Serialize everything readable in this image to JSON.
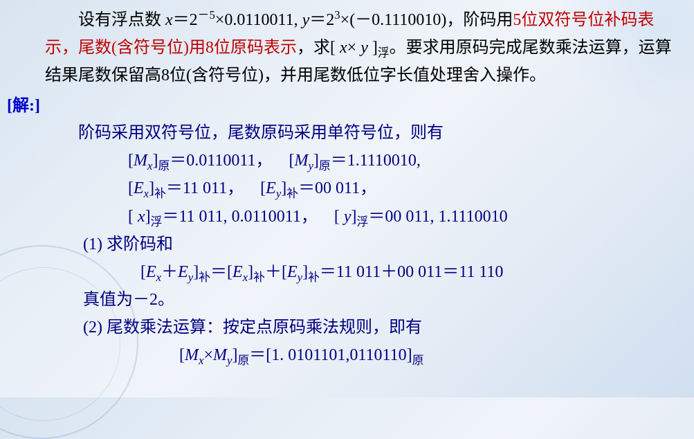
{
  "problem": {
    "line1_a": "设有浮点数 ",
    "line1_x": "x",
    "line1_b": "＝2",
    "line1_exp1": "－5",
    "line1_c": "×0.0110011, ",
    "line1_y": "y",
    "line1_d": "＝2",
    "line1_exp2": "3",
    "line1_e": "×(－0.1110010)，阶码用",
    "line1_red1": "5位双符号位补码表示，尾数(含符号位)用8位原码表示",
    "line1_f": "，求[ ",
    "line1_x2": "x",
    "line1_g": "× ",
    "line1_y2": "y",
    "line1_h": " ]",
    "line1_sub1": "浮",
    "line1_i": "。要求用原码完成尾数乘法运算，运算结果尾数保留高8位(含符号位)，并用尾数低位字长值处理舍入操作。"
  },
  "solution_label": "[解:]",
  "solution": {
    "intro": "阶码采用双符号位，尾数原码采用单符号位，则有",
    "mx_label_a": "[",
    "mx_label_b": "M",
    "mx_sub": "x",
    "mx_label_c": "]",
    "mx_sub2": "原",
    "mx_val": "＝0.0110011，",
    "my_label_a": "[",
    "my_label_b": "M",
    "my_sub": "y",
    "my_label_c": "]",
    "my_sub2": "原",
    "my_val": "＝1.1110010,",
    "ex_label_a": "[",
    "ex_label_b": "E",
    "ex_sub": "x",
    "ex_label_c": "]",
    "ex_sub2": "补",
    "ex_val": "＝11 011，",
    "ey_label_a": "[",
    "ey_label_b": "E",
    "ey_sub": "y",
    "ey_label_c": "]",
    "ey_sub2": "补",
    "ey_val": "＝00 011，",
    "xf_label_a": "[ ",
    "xf_label_b": "x",
    "xf_label_c": "]",
    "xf_sub": "浮",
    "xf_val": "＝11 011, 0.0110011，",
    "yf_label_a": "[ ",
    "yf_label_b": "y",
    "yf_label_c": "]",
    "yf_sub": "浮",
    "yf_val": "＝00 011, 1.1110010",
    "step1": "(1) 求阶码和",
    "step1_formula_a": "[",
    "step1_formula_b": "E",
    "step1_formula_sub1": "x",
    "step1_formula_c": "＋",
    "step1_formula_d": "E",
    "step1_formula_sub2": "y",
    "step1_formula_e": "]",
    "step1_formula_sub3": "补",
    "step1_formula_f": "＝[",
    "step1_formula_g": "E",
    "step1_formula_sub4": "x",
    "step1_formula_h": "]",
    "step1_formula_sub5": "补",
    "step1_formula_i": "＋[",
    "step1_formula_j": "E",
    "step1_formula_sub6": "y",
    "step1_formula_k": "]",
    "step1_formula_sub7": "补",
    "step1_formula_l": "＝11 011＋00 011＝11 110",
    "step1_result": "真值为－2。",
    "step2": "(2) 尾数乘法运算：按定点原码乘法规则，即有",
    "step2_formula_a": "[",
    "step2_formula_b": "M",
    "step2_formula_sub1": "x",
    "step2_formula_c": "×",
    "step2_formula_d": "M",
    "step2_formula_sub2": "y",
    "step2_formula_e": "]",
    "step2_formula_sub3": "原",
    "step2_formula_f": "＝[1. 0101101,0110110]",
    "step2_formula_sub4": "原"
  }
}
